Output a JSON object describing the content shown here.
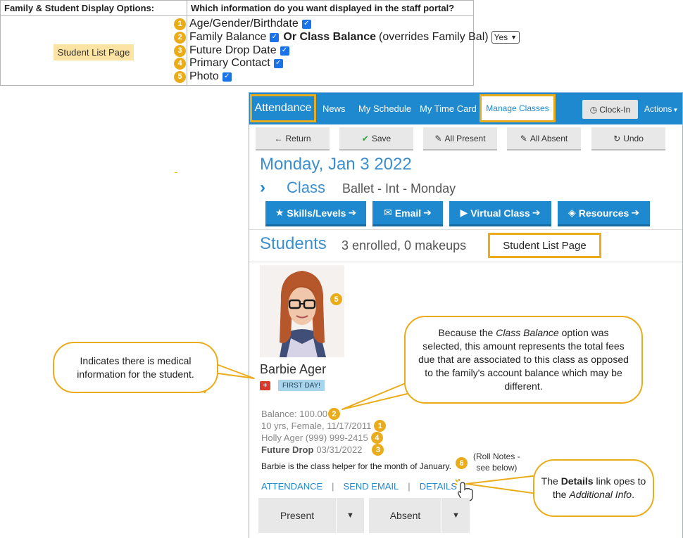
{
  "options_table": {
    "header_left": "Family & Student Display Options:",
    "header_right": "Which information do you want displayed in the staff portal?",
    "page_label": "Student List Page",
    "rows": [
      {
        "num": "1",
        "label": "Age/Gender/Birthdate",
        "checked": true
      },
      {
        "num": "2",
        "label": "Family Balance",
        "checked": true,
        "or_label": "Or Class Balance",
        "or_note": "(overrides Family Bal)",
        "select_value": "Yes"
      },
      {
        "num": "3",
        "label": "Future Drop Date",
        "checked": true
      },
      {
        "num": "4",
        "label": "Primary Contact",
        "checked": true
      },
      {
        "num": "5",
        "label": "Photo",
        "checked": true
      }
    ]
  },
  "nav": {
    "brand": "Attendance",
    "items": [
      "News",
      "My Schedule",
      "My Time Card",
      "Manage Classes"
    ],
    "clock_in": "Clock-In",
    "actions": "Actions"
  },
  "toolbar": {
    "return": "Return",
    "save": "Save",
    "all_present": "All Present",
    "all_absent": "All Absent",
    "undo": "Undo"
  },
  "session": {
    "date": "Monday, Jan 3 2022",
    "class_label": "Class",
    "class_name": "Ballet - Int - Monday"
  },
  "action_buttons": {
    "skills": "Skills/Levels",
    "email": "Email",
    "virtual": "Virtual Class",
    "resources": "Resources"
  },
  "students": {
    "label": "Students",
    "count": "3 enrolled, 0 makeups",
    "page_box": "Student List Page"
  },
  "student": {
    "photo_num": "5",
    "name": "Barbie Ager",
    "badge": "FIRST DAY!",
    "balance": "Balance: 100.00",
    "balance_num": "2",
    "age_line": "10 yrs, Female, 11/17/2011",
    "age_num": "1",
    "contact": "Holly Ager (999) 999-2415",
    "contact_num": "4",
    "future_drop_label": "Future Drop",
    "future_drop_date": "03/31/2022",
    "future_drop_num": "3",
    "note": "Barbie is the class helper for the month of January.",
    "note_num": "6",
    "roll_notes": "(Roll Notes -",
    "roll_notes_2": "see below)",
    "links": [
      "ATTENDANCE",
      "SEND EMAIL",
      "DETAILS"
    ],
    "present": "Present",
    "absent": "Absent"
  },
  "callouts": {
    "medical": "Indicates there is medical information for the student.",
    "balance_1": "Because the",
    "balance_em": "Class Balance",
    "balance_2": "option was selected, this amount represents the total fees due that are associated to this class as opposed to the family's account balance which may be different.",
    "details_1": "The",
    "details_b": "Details",
    "details_2": "link opes to the",
    "details_em": "Additional Info",
    "details_3": "."
  },
  "colors": {
    "accent": "#1f89cf",
    "highlight": "#eaac1b",
    "medical": "#d83a2b"
  }
}
